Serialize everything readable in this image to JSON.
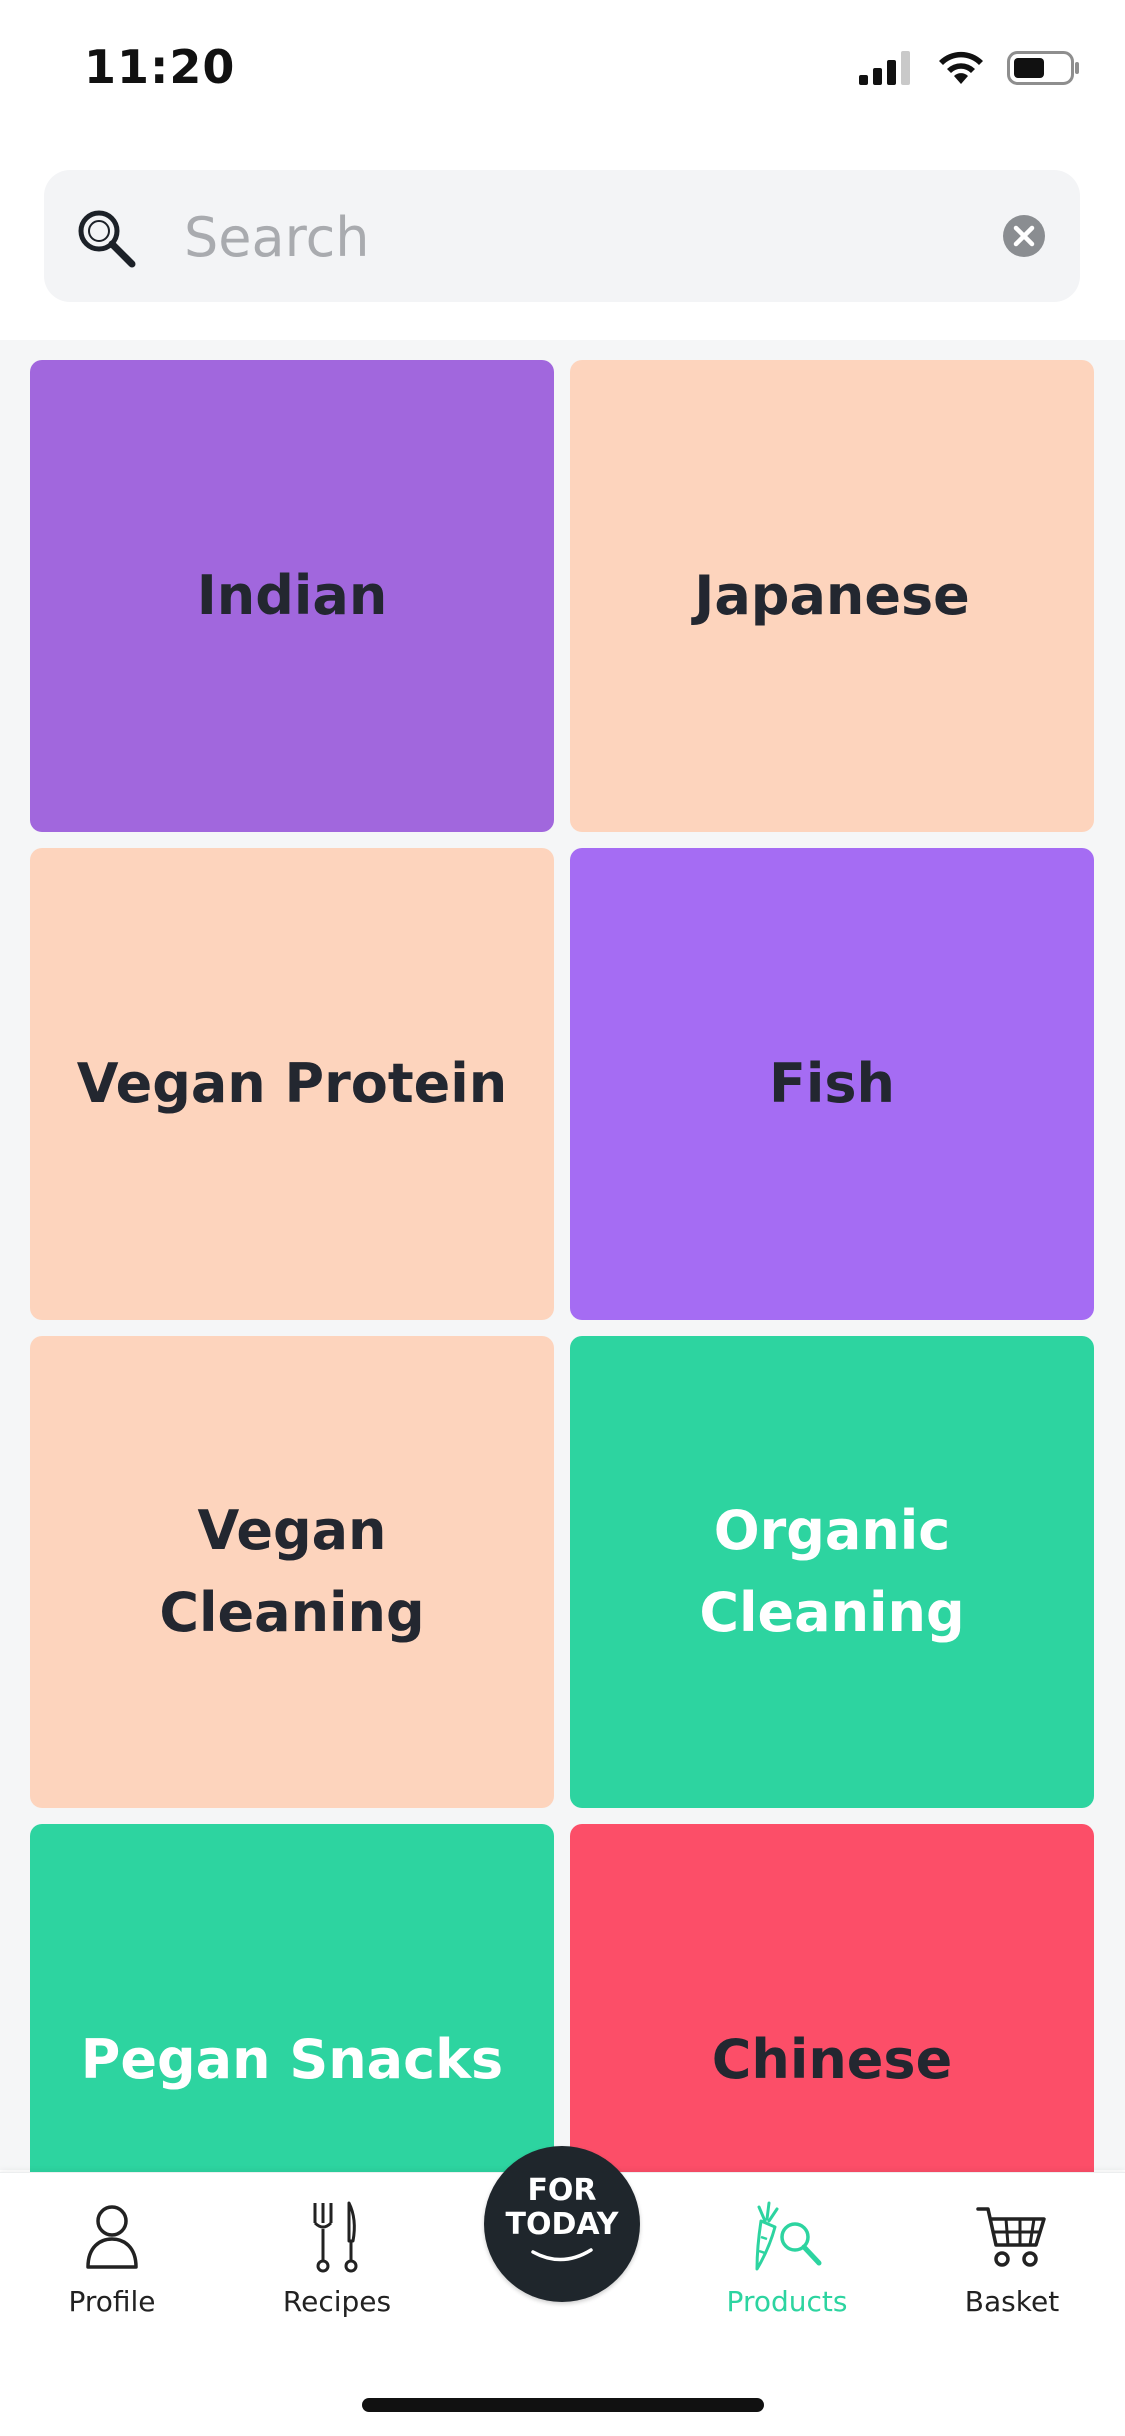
{
  "status_bar": {
    "time": "11:20"
  },
  "search": {
    "placeholder": "Search",
    "value": ""
  },
  "categories": [
    {
      "label": "Indian",
      "color": "#a167dd",
      "text_color": "dark"
    },
    {
      "label": "Japanese",
      "color": "#fdd4bd",
      "text_color": "dark"
    },
    {
      "label": "Vegan Protein",
      "color": "#fdd4bd",
      "text_color": "dark"
    },
    {
      "label": "Fish",
      "color": "#a56cf3",
      "text_color": "dark"
    },
    {
      "label": "Vegan Cleaning",
      "color": "#fdd4bd",
      "text_color": "dark"
    },
    {
      "label": "Organic Cleaning",
      "color": "#2dd4a0",
      "text_color": "light"
    },
    {
      "label": "Pegan Snacks",
      "color": "#2dd4a0",
      "text_color": "light"
    },
    {
      "label": "Chinese",
      "color": "#fc4e68",
      "text_color": "dark"
    }
  ],
  "tab_bar": {
    "active_color": "#2dd4a0",
    "items": [
      {
        "label": "Profile",
        "icon": "profile-icon",
        "active": false
      },
      {
        "label": "Recipes",
        "icon": "recipes-icon",
        "active": false
      },
      {
        "label": "Products",
        "icon": "products-icon",
        "active": true
      },
      {
        "label": "Basket",
        "icon": "basket-icon",
        "active": false
      }
    ],
    "center_button": {
      "line1": "FOR",
      "line2": "TODAY"
    }
  }
}
